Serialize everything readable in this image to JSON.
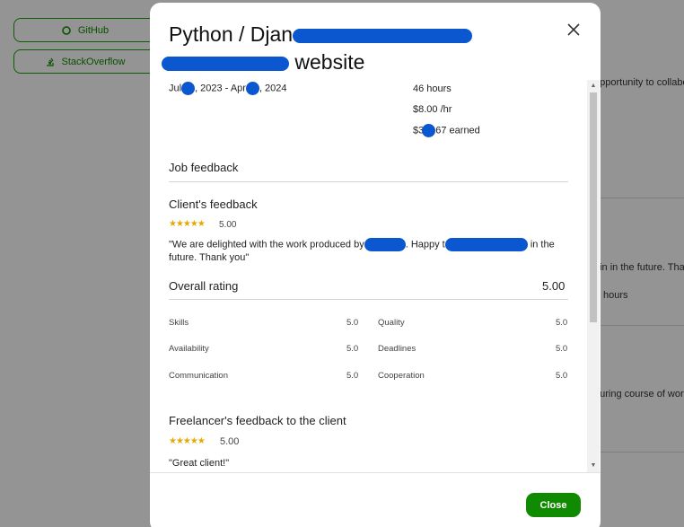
{
  "background": {
    "buttons": [
      {
        "label": "GitHub",
        "icon": "github-icon"
      },
      {
        "label": "StackOverflow",
        "icon": "stackoverflow-icon"
      }
    ],
    "snippets": [
      "opportunity to collabo",
      "ain in the future. Tha",
      "hours",
      "during course of wor"
    ]
  },
  "modal": {
    "title_part1": "Python / Djan",
    "title_part2": "website",
    "date_start": "Jul",
    "date_mid": ", 2023 - Apr",
    "date_end": ", 2024",
    "hours": "46 hours",
    "rate": "$8.00 /hr",
    "earned_prefix": "$3",
    "earned_suffix": "67 earned",
    "job_feedback_heading": "Job feedback",
    "client_feedback": {
      "heading": "Client's feedback",
      "stars": "★★★★★",
      "score": "5.00",
      "quote_part1": "\"We are delighted with the work produced by",
      "quote_part2": ". Happy t",
      "quote_part3": "in the",
      "quote_part4": "future. Thank you\""
    },
    "overall": {
      "label": "Overall rating",
      "score": "5.00"
    },
    "ratings_left": [
      {
        "label": "Skills",
        "value": "5.0"
      },
      {
        "label": "Availability",
        "value": "5.0"
      },
      {
        "label": "Communication",
        "value": "5.0"
      }
    ],
    "ratings_right": [
      {
        "label": "Quality",
        "value": "5.0"
      },
      {
        "label": "Deadlines",
        "value": "5.0"
      },
      {
        "label": "Cooperation",
        "value": "5.0"
      }
    ],
    "freelancer_feedback": {
      "heading": "Freelancer's feedback to the client",
      "stars": "★★★★★",
      "score": "5.00",
      "quote": "\"Great client!\""
    },
    "close_label": "Close"
  },
  "colors": {
    "brand_green": "#108a00",
    "star": "#e6a900",
    "redaction": "#0b57d0"
  }
}
